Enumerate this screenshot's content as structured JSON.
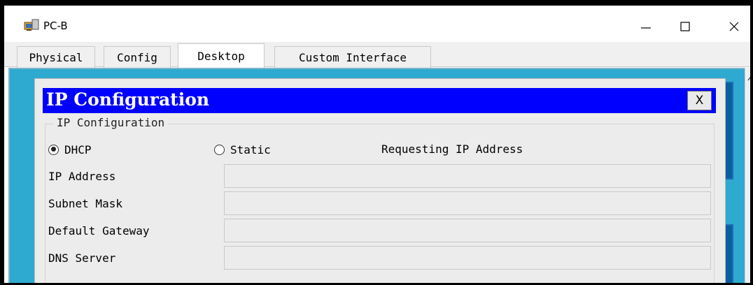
{
  "window": {
    "title": "PC-B",
    "controls": {
      "minimize_icon": "minimize-icon",
      "maximize_icon": "maximize-icon",
      "close_icon": "close-icon"
    }
  },
  "tabs": [
    {
      "label": "Physical",
      "active": false
    },
    {
      "label": "Config",
      "active": false
    },
    {
      "label": "Desktop",
      "active": true
    },
    {
      "label": "Custom Interface",
      "active": false
    }
  ],
  "ip_config": {
    "title": "IP Configuration",
    "close_label": "X",
    "group_label": "IP Configuration",
    "mode": {
      "dhcp_label": "DHCP",
      "static_label": "Static",
      "selected": "DHCP"
    },
    "status": "Requesting IP Address",
    "fields": [
      {
        "label": "IP Address",
        "value": ""
      },
      {
        "label": "Subnet Mask",
        "value": ""
      },
      {
        "label": "Default Gateway",
        "value": ""
      },
      {
        "label": "DNS Server",
        "value": ""
      }
    ]
  },
  "colors": {
    "header_blue": "#0000ff",
    "desktop_bg": "#2ea9cf",
    "panel_bg": "#ececec"
  }
}
